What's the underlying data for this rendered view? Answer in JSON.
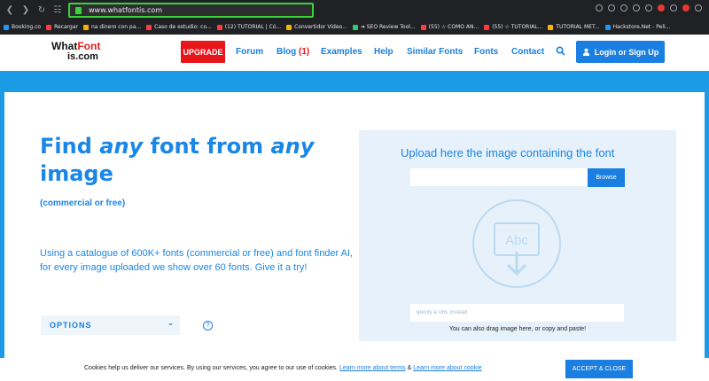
{
  "browser": {
    "url": "www.whatfontis.com",
    "bookmarks": [
      {
        "label": "Booking.co",
        "color": "b"
      },
      {
        "label": "Recargar",
        "color": "r"
      },
      {
        "label": "na dinero con pa...",
        "color": "y"
      },
      {
        "label": "Caso de estudio: co...",
        "color": "r"
      },
      {
        "label": "(12) TUTORIAL | Có...",
        "color": "r"
      },
      {
        "label": "Convertidor Video...",
        "color": "y"
      },
      {
        "label": "➜ SEO Review Tool...",
        "color": "g"
      },
      {
        "label": "(55) ☆ COMO AN...",
        "color": "r"
      },
      {
        "label": "(55) ☆ TUTORIAL...",
        "color": "r"
      },
      {
        "label": "TUTORIAL MET...",
        "color": "y"
      },
      {
        "label": "Hackstore.Net - Peli...",
        "color": "b"
      }
    ]
  },
  "header": {
    "logo_line1_a": "What",
    "logo_line1_b": "Font",
    "logo_line2": "is.com",
    "upgrade": "UPGRADE",
    "menu": {
      "forum": "Forum",
      "blog": "Blog",
      "blog_count": "(1)",
      "examples": "Examples",
      "help": "Help",
      "similar": "Similar Fonts",
      "fonts": "Fonts",
      "contact": "Contact"
    },
    "login": "Login or Sign Up"
  },
  "hero": {
    "t1": "Find ",
    "t2": "any",
    "t3": " font from ",
    "t4": "any",
    "t5": "image",
    "subtitle": "(commercial or free)",
    "description": "Using a catalogue of 600K+ fonts (commercial or free) and font finder AI, for every image uploaded we show over 60 fonts. Give it a try!",
    "options": "OPTIONS",
    "help_mark": "?"
  },
  "upload": {
    "title": "Upload here the image containing the font",
    "browse": "Browse",
    "icon_text": "Abc",
    "url_placeholder": "specify a URL instead",
    "drag_note": "You can also drag image here, or copy and paste!"
  },
  "cookie": {
    "text": "Cookies help us deliver our services. By using our services, you agree to our use of cookies.",
    "link1": "Learn more about terms",
    "amp": " & ",
    "link2": "Learn more about cookie",
    "accept": "ACCEPT & CLOSE"
  }
}
